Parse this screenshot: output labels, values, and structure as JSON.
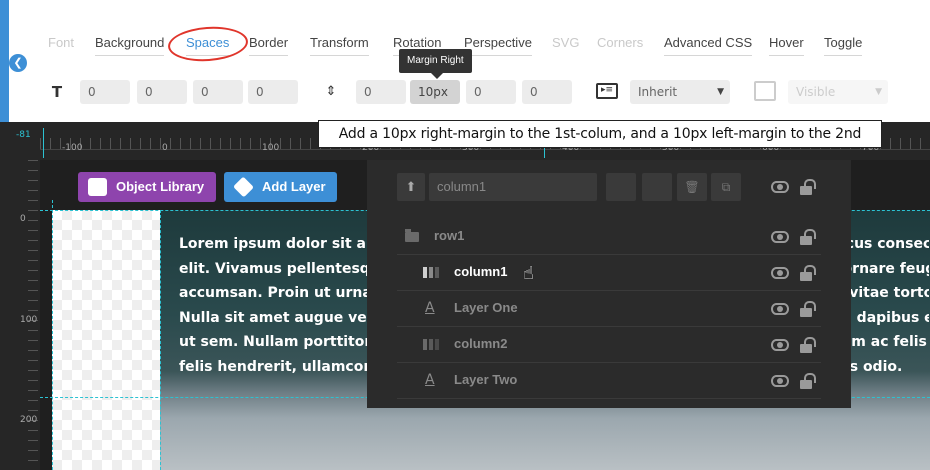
{
  "tabs": [
    {
      "label": "Font",
      "state": "disabled"
    },
    {
      "label": "Background",
      "state": "normal"
    },
    {
      "label": "Spaces",
      "state": "active"
    },
    {
      "label": "Border",
      "state": "normal"
    },
    {
      "label": "Transform",
      "state": "normal"
    },
    {
      "label": "Rotation",
      "state": "normal"
    },
    {
      "label": "Perspective",
      "state": "normal"
    },
    {
      "label": "SVG",
      "state": "disabled"
    },
    {
      "label": "Corners",
      "state": "disabled"
    },
    {
      "label": "Advanced CSS",
      "state": "normal"
    },
    {
      "label": "Hover",
      "state": "normal"
    },
    {
      "label": "Toggle",
      "state": "normal"
    }
  ],
  "padding_fields": [
    "0",
    "0",
    "0",
    "0"
  ],
  "margin_fields": [
    "0",
    "10px",
    "0",
    "0"
  ],
  "overflow_select": "Inherit",
  "visibility_select": "Visible",
  "tooltip": "Margin Right",
  "callout": "Add a 10px right-margin to the 1st-colum, and a 10px left-margin to the 2nd",
  "ruler_top_labels": [
    "-100",
    "0",
    "100",
    "200",
    "300",
    "400",
    "500",
    "600",
    "700"
  ],
  "ruler_left_labels": [
    "0",
    "100",
    "200"
  ],
  "ruler_marker": "-81",
  "buttons": {
    "object_library": "Object Library",
    "add_layer": "Add Layer"
  },
  "lorem_lines": [
    "Lorem ipsum dolor sit amet, consectetur adipiscing elit. Nullam eu lorem sit amet lacus consectetur a",
    "elit. Vivamus pellentesque nunc a vestibulum viverra. Integer vitae magna a ipsum ornare feugia",
    "accumsan. Proin ut urna eget massa venenatis scelerisque. Pellentesque quis tellus vitae tortor pulvinar. N",
    "Nulla sit amet augue vel velit euismod efficitur. Donec ullamcorper, lorem a interdum dapibus eu u",
    "ut sem. Nullam porttitor velit et diam tincidunt, vitae malesuada erat vulputate. Etiam ac felis",
    "felis hendrerit, ullamcorper libero et, tincidunt nisl. Quisque vel massa at enim luctus odio."
  ],
  "layers_panel": {
    "selected_name": "column1",
    "rows": [
      {
        "name": "row1",
        "type": "row",
        "indent": false,
        "active": false
      },
      {
        "name": "column1",
        "type": "column",
        "indent": true,
        "active": true
      },
      {
        "name": "Layer One",
        "type": "text",
        "indent": true,
        "active": false
      },
      {
        "name": "column2",
        "type": "column",
        "indent": true,
        "active": false
      },
      {
        "name": "Layer Two",
        "type": "text",
        "indent": true,
        "active": false
      }
    ]
  },
  "colors": {
    "accent": "#3d8fd6",
    "object_library": "#8e44ad",
    "add_layer": "#3d8fd6",
    "guide": "#2cc2d2",
    "highlight_circle": "#e0352b"
  }
}
